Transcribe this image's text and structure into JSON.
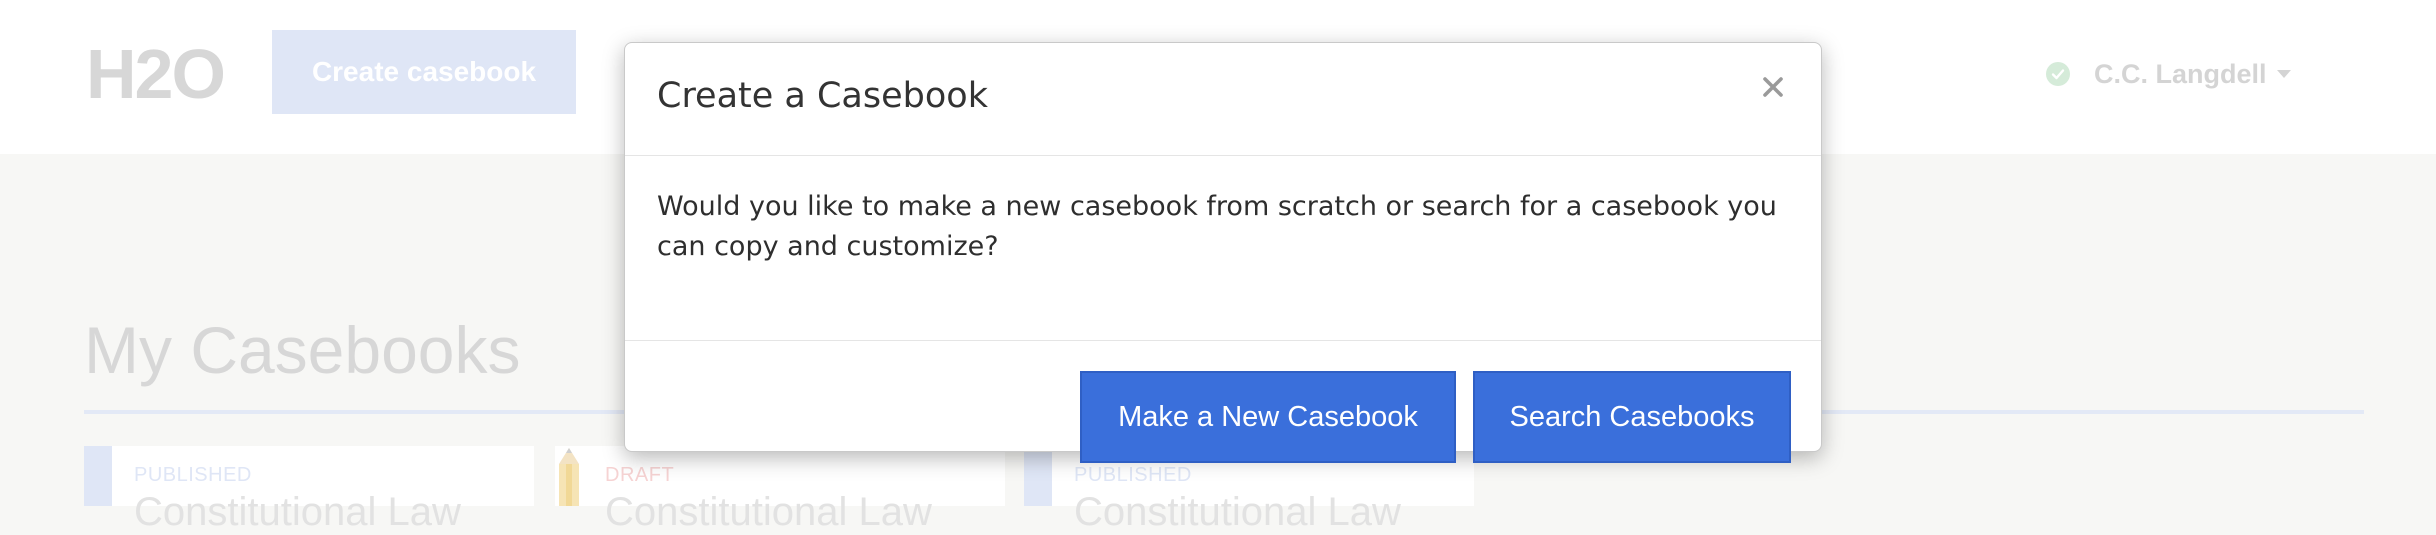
{
  "header": {
    "logo": "H2O",
    "create_button": "Create casebook",
    "user_name": "C.C. Langdell"
  },
  "main": {
    "section_title": "My Casebooks",
    "cards": [
      {
        "status": "PUBLISHED",
        "title": "Constitutional Law"
      },
      {
        "status": "DRAFT",
        "title": "Constitutional Law"
      },
      {
        "status": "PUBLISHED",
        "title": "Constitutional Law"
      }
    ]
  },
  "modal": {
    "title": "Create a Casebook",
    "close_label": "×",
    "body": "Would you like to make a new casebook from scratch or search for a casebook you can copy and customize?",
    "make_new_button": "Make a New Casebook",
    "search_button": "Search Casebooks"
  },
  "colors": {
    "primary": "#3a6fdb",
    "background": "#f7f7f5",
    "status_online": "#5cb85c"
  }
}
